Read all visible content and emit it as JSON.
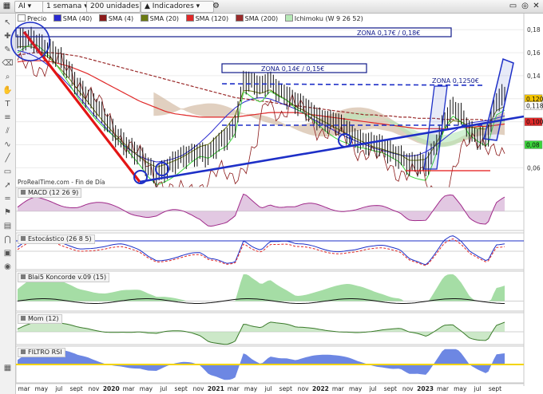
{
  "toolbar": {
    "instrument": "AI",
    "timeframe": "1 semana",
    "units": "200 unidades",
    "indicators": "Indicadores"
  },
  "legend": {
    "price": "Precio",
    "sma40": "SMA (40)",
    "sma4": "SMA (4)",
    "sma20": "SMA (20)",
    "sma120": "SMA (120)",
    "sma200": "SMA (200)",
    "ichimoku": "Ichimoku (W 9 26 52)"
  },
  "footer": "ProRealTime.com - Fin de Día",
  "zones": {
    "z1": "ZONA 0,17€ / 0,18€",
    "z2": "ZONA 0,14€ / 0,15€",
    "z3": "ZONA 0,1250€"
  },
  "panels": {
    "macd": "MACD (12 26 9)",
    "stoch": "Estocástico (26 8 5)",
    "blai5": "Blai5 Koncorde v.09 (15)",
    "mom": "Mom (12)",
    "rsi": "FILTRO RSI"
  },
  "colors": {
    "price": "#111111",
    "sma40": "#2a2ad0",
    "sma4": "#8b1a1a",
    "sma20": "#6b7a12",
    "sma120": "#e02828",
    "sma200": "#9a2a2a",
    "tenkan": "#3ad63a",
    "cloud_bear": "#c8a98c",
    "cloud_bull": "#b6e8b6",
    "trend_blue": "#1d2fc7",
    "trend_red": "#e31515",
    "zone_navy": "#101a8a"
  },
  "chart_data": {
    "type": "line",
    "price_axis": {
      "ticks": [
        "0,18",
        "0,16",
        "0,14",
        "0,12",
        "0,10",
        "0,08",
        "0,06"
      ],
      "range": [
        0.045,
        0.185
      ]
    },
    "last_labels": [
      "0,120",
      "0,118",
      "0,100",
      "0,08"
    ],
    "x_labels": [
      "mar",
      "may",
      "jul",
      "sept",
      "nov",
      "2020",
      "mar",
      "may",
      "jul",
      "sept",
      "nov",
      "2021",
      "mar",
      "may",
      "jul",
      "sept",
      "nov",
      "2022",
      "mar",
      "may",
      "jul",
      "sept",
      "nov",
      "2023",
      "mar",
      "may",
      "jul",
      "sept"
    ],
    "series": [
      {
        "name": "Precio",
        "values": [
          0.168,
          0.171,
          0.172,
          0.166,
          0.16,
          0.152,
          0.143,
          0.132,
          0.123,
          0.112,
          0.102,
          0.093,
          0.085,
          0.076,
          0.069,
          0.061,
          0.056,
          0.06,
          0.064,
          0.068,
          0.072,
          0.075,
          0.072,
          0.079,
          0.085,
          0.098,
          0.138,
          0.133,
          0.128,
          0.136,
          0.129,
          0.123,
          0.115,
          0.112,
          0.108,
          0.104,
          0.1,
          0.096,
          0.092,
          0.087,
          0.083,
          0.079,
          0.077,
          0.074,
          0.072,
          0.063,
          0.062,
          0.061,
          0.08,
          0.101,
          0.111,
          0.104,
          0.092,
          0.088,
          0.086,
          0.116,
          0.122
        ]
      },
      {
        "name": "SMA (40)",
        "values": [
          0.162,
          0.16,
          0.157,
          0.152,
          0.146,
          0.139,
          0.131,
          0.122,
          0.113,
          0.104,
          0.096,
          0.088,
          0.081,
          0.075,
          0.07,
          0.067,
          0.065,
          0.066,
          0.068,
          0.071,
          0.076,
          0.082,
          0.089,
          0.097,
          0.105,
          0.112,
          0.117,
          0.12,
          0.121,
          0.12,
          0.117,
          0.114,
          0.111,
          0.107,
          0.102,
          0.098,
          0.094,
          0.09,
          0.086,
          0.083,
          0.08,
          0.077,
          0.075,
          0.073,
          0.071,
          0.07,
          0.071,
          0.074,
          0.079,
          0.085,
          0.091,
          0.096,
          0.099,
          0.1,
          0.101,
          0.103,
          0.105
        ]
      },
      {
        "name": "SMA (120)",
        "values": [
          0.152,
          0.153,
          0.153,
          0.153,
          0.152,
          0.15,
          0.148,
          0.145,
          0.142,
          0.138,
          0.134,
          0.13,
          0.126,
          0.122,
          0.118,
          0.115,
          0.112,
          0.109,
          0.107,
          0.106,
          0.105,
          0.104,
          0.104,
          0.104,
          0.104,
          0.104,
          0.105,
          0.106,
          0.107,
          0.108,
          0.108,
          0.108,
          0.108,
          0.107,
          0.106,
          0.105,
          0.104,
          0.103,
          0.102,
          0.101,
          0.1,
          0.099,
          0.098,
          0.097,
          0.096,
          0.095,
          0.094,
          0.094,
          0.094,
          0.094,
          0.094,
          0.095,
          0.095,
          0.096,
          0.096,
          0.097,
          0.098
        ]
      },
      {
        "name": "SMA (200)",
        "values": [
          0.158,
          0.159,
          0.16,
          0.16,
          0.16,
          0.159,
          0.158,
          0.157,
          0.155,
          0.153,
          0.151,
          0.149,
          0.147,
          0.145,
          0.143,
          0.141,
          0.139,
          0.137,
          0.135,
          0.133,
          0.131,
          0.129,
          0.127,
          0.125,
          0.123,
          0.121,
          0.12,
          0.119,
          0.118,
          0.117,
          0.116,
          0.115,
          0.114,
          0.113,
          0.112,
          0.111,
          0.11,
          0.109,
          0.108,
          0.107,
          0.106,
          0.106,
          0.105,
          0.105,
          0.104,
          0.104,
          0.103,
          0.103,
          0.103,
          0.102,
          0.102,
          0.102,
          0.102,
          0.102,
          0.101,
          0.101,
          0.101
        ]
      }
    ]
  }
}
